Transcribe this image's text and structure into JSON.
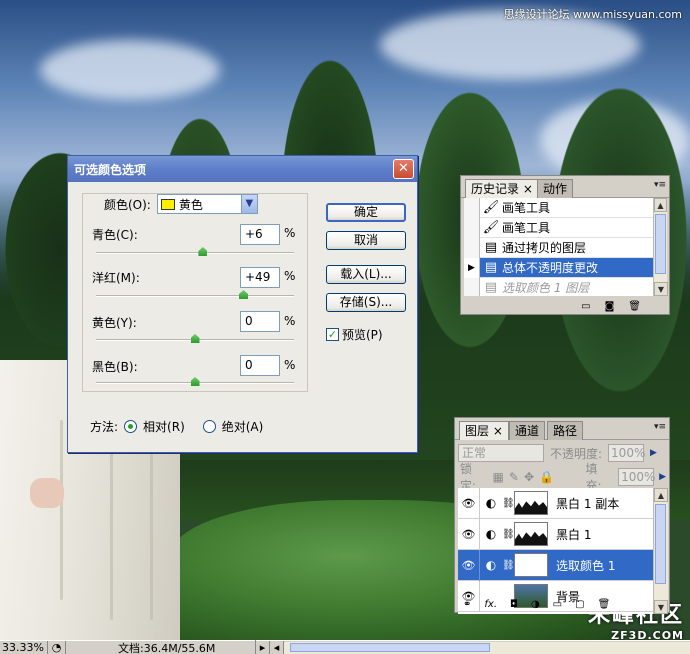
{
  "watermark": {
    "top_text": "思缘设计论坛 www.missyuan.com",
    "logo_text": "朱峰社区",
    "logo_sub": "ZF3D.COM"
  },
  "dialog": {
    "title": "可选颜色选项",
    "color_label": "颜色(O):",
    "color_value": "黄色",
    "sliders": [
      {
        "label": "青色(C):",
        "value": "+6",
        "unit": "%",
        "fraction": 0.54
      },
      {
        "label": "洋红(M):",
        "value": "+49",
        "unit": "%",
        "fraction": 0.745
      },
      {
        "label": "黄色(Y):",
        "value": "0",
        "unit": "%",
        "fraction": 0.5
      },
      {
        "label": "黑色(B):",
        "value": "0",
        "unit": "%",
        "fraction": 0.5
      }
    ],
    "buttons": {
      "ok": "确定",
      "cancel": "取消",
      "load": "载入(L)...",
      "save": "存储(S)..."
    },
    "preview_label": "预览(P)",
    "method_label": "方法:",
    "method_relative": "相对(R)",
    "method_absolute": "绝对(A)"
  },
  "history_panel": {
    "tab_history": "历史记录",
    "tab_actions": "动作",
    "items": [
      {
        "label": "画笔工具",
        "icon": "brush-icon"
      },
      {
        "label": "画笔工具",
        "icon": "brush-icon"
      },
      {
        "label": "通过拷贝的图层",
        "icon": "document-icon"
      },
      {
        "label": "总体不透明度更改",
        "icon": "document-icon"
      },
      {
        "label": "选取颜色 1 图层",
        "icon": "document-icon"
      }
    ]
  },
  "layers_panel": {
    "tab_layers": "图层",
    "tab_channels": "通道",
    "tab_paths": "路径",
    "blend_mode": "正常",
    "opacity_label": "不透明度:",
    "opacity_value": "100%",
    "lock_label": "锁定:",
    "fill_label": "填充:",
    "fill_value": "100%",
    "layers": [
      {
        "name": "黑白 1 副本"
      },
      {
        "name": "黑白 1"
      },
      {
        "name": "选取颜色 1"
      },
      {
        "name": "背景"
      }
    ]
  },
  "statusbar": {
    "zoom": "33.33%",
    "doc": "文档:36.4M/55.6M"
  },
  "colors": {
    "title_blue": "#5e7ec9",
    "selection_blue": "#3169c6",
    "swatch_yellow": "#ffee00"
  }
}
